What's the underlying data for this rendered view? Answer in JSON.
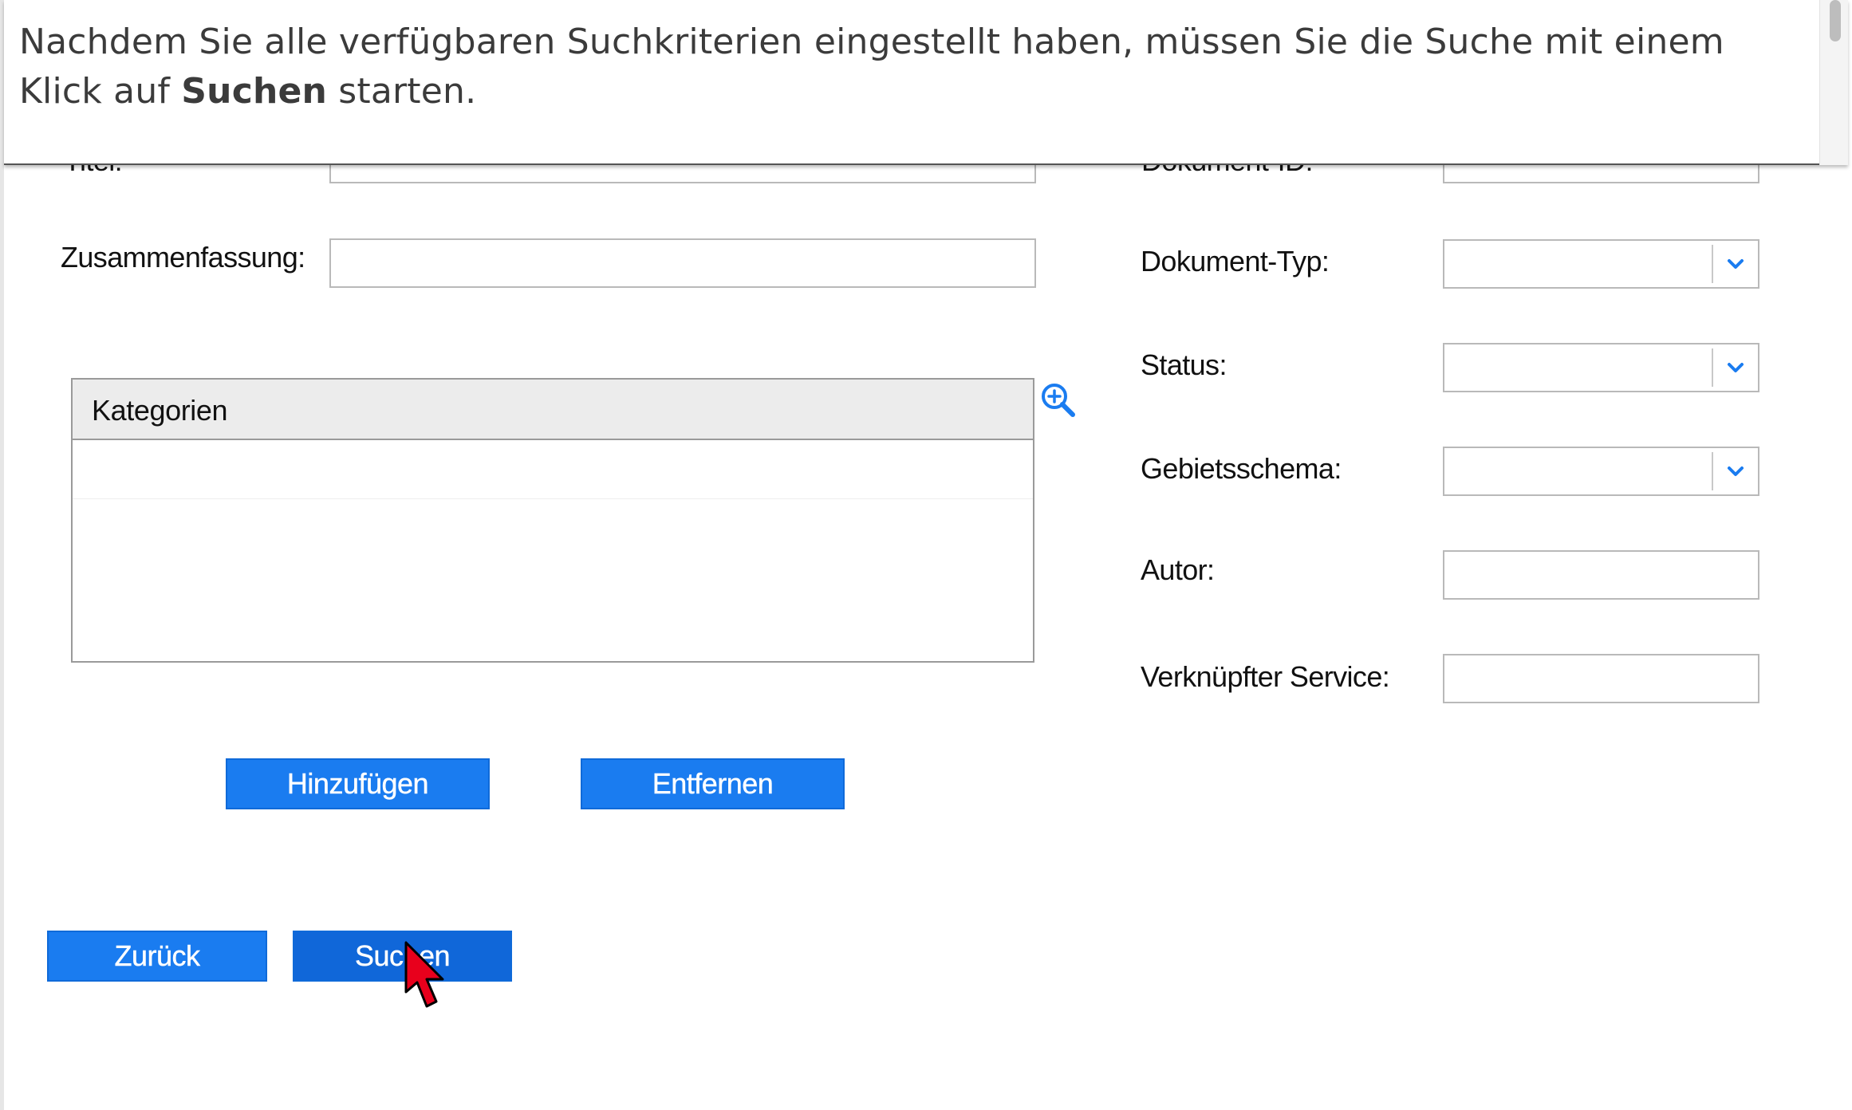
{
  "banner": {
    "text_before": "Nachdem Sie alle verfügbaren Suchkriterien eingestellt haben, müssen Sie die Suche mit einem Klick auf ",
    "text_bold": "Suchen",
    "text_after": " starten."
  },
  "form": {
    "titel_label": "Titel:",
    "dokument_id_label": "Dokument-ID:",
    "zusammenfassung_label": "Zusammenfassung:",
    "dokument_typ_label": "Dokument-Typ:",
    "status_label": "Status:",
    "gebietsschema_label": "Gebietsschema:",
    "autor_label": "Autor:",
    "verknuepfter_service_label": "Verknüpfter Service:"
  },
  "categories": {
    "header": "Kategorien"
  },
  "buttons": {
    "add": "Hinzufügen",
    "remove": "Entfernen",
    "back": "Zurück",
    "search": "Suchen"
  },
  "colors": {
    "button_blue": "#1a7cf0",
    "icon_blue": "#1a7cf0",
    "cursor_red": "#e8001c"
  },
  "icons": {
    "zoom": "zoom-in-icon",
    "dropdown": "chevron-down-icon",
    "cursor": "mouse-pointer-icon"
  }
}
